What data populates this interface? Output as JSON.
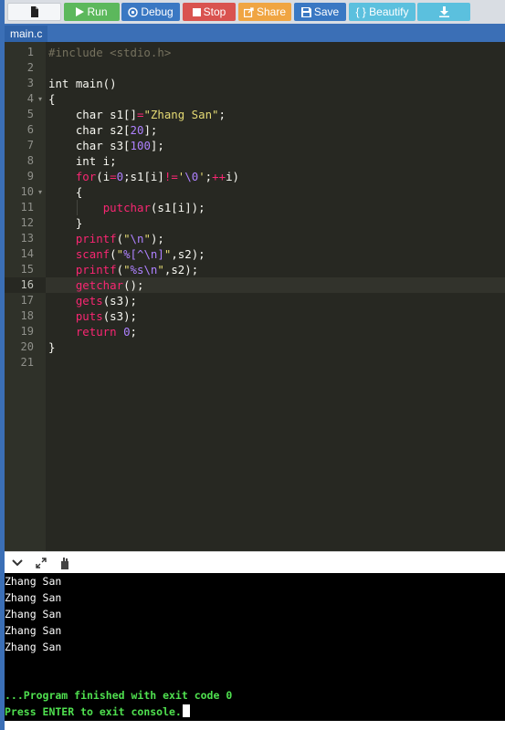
{
  "toolbar": {
    "run_label": "Run",
    "debug_label": "Debug",
    "stop_label": "Stop",
    "share_label": "Share",
    "save_label": "Save",
    "beautify_label": "{ } Beautify"
  },
  "tabs": [
    {
      "label": "main.c",
      "active": true
    }
  ],
  "editor": {
    "active_line": 16,
    "lines": [
      {
        "n": "1",
        "text": "#include <stdio.h>"
      },
      {
        "n": "2",
        "text": ""
      },
      {
        "n": "3",
        "text": "int main()"
      },
      {
        "n": "4",
        "text": "{"
      },
      {
        "n": "5",
        "text": "    char s1[]=\"Zhang San\";"
      },
      {
        "n": "6",
        "text": "    char s2[20];"
      },
      {
        "n": "7",
        "text": "    char s3[100];"
      },
      {
        "n": "8",
        "text": "    int i;"
      },
      {
        "n": "9",
        "text": "    for(i=0;s1[i]!='\\0';++i)"
      },
      {
        "n": "10",
        "text": "    {"
      },
      {
        "n": "11",
        "text": "        putchar(s1[i]);"
      },
      {
        "n": "12",
        "text": "    }"
      },
      {
        "n": "13",
        "text": "    printf(\"\\n\");"
      },
      {
        "n": "14",
        "text": "    scanf(\"%[^\\n]\",s2);"
      },
      {
        "n": "15",
        "text": "    printf(\"%s\\n\",s2);"
      },
      {
        "n": "16",
        "text": "    getchar();"
      },
      {
        "n": "17",
        "text": "    gets(s3);"
      },
      {
        "n": "18",
        "text": "    puts(s3);"
      },
      {
        "n": "19",
        "text": "    return 0;"
      },
      {
        "n": "20",
        "text": "}"
      },
      {
        "n": "21",
        "text": ""
      }
    ]
  },
  "console": {
    "output_lines": [
      "Zhang San",
      "Zhang San",
      "Zhang San",
      "Zhang San",
      "Zhang San"
    ],
    "finished_message": "...Program finished with exit code 0",
    "prompt_message": "Press ENTER to exit console."
  },
  "colors": {
    "run": "#5cb85c",
    "debug": "#3a78c3",
    "stop": "#d9534f",
    "share": "#f0a542",
    "save": "#3a78c3",
    "beautify": "#5bc0de",
    "editor_bg": "#272822",
    "console_text_green": "#4fe04f"
  },
  "icons": [
    "new-file-icon",
    "play-icon",
    "debug-icon",
    "stop-icon",
    "share-icon",
    "save-icon",
    "download-icon",
    "chevron-down-icon",
    "expand-icon",
    "settings-icon"
  ]
}
